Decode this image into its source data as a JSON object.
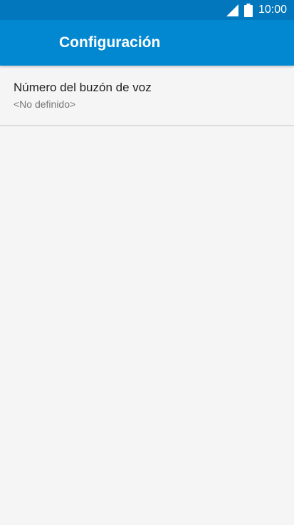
{
  "status_bar": {
    "time": "10:00",
    "icons": [
      "signal-icon",
      "battery-icon"
    ],
    "bg_color": "#0277bd"
  },
  "app_bar": {
    "title": "Configuración",
    "bg_color": "#0288d1"
  },
  "preferences": [
    {
      "title": "Número del buzón de voz",
      "summary": "<No definido>"
    }
  ]
}
